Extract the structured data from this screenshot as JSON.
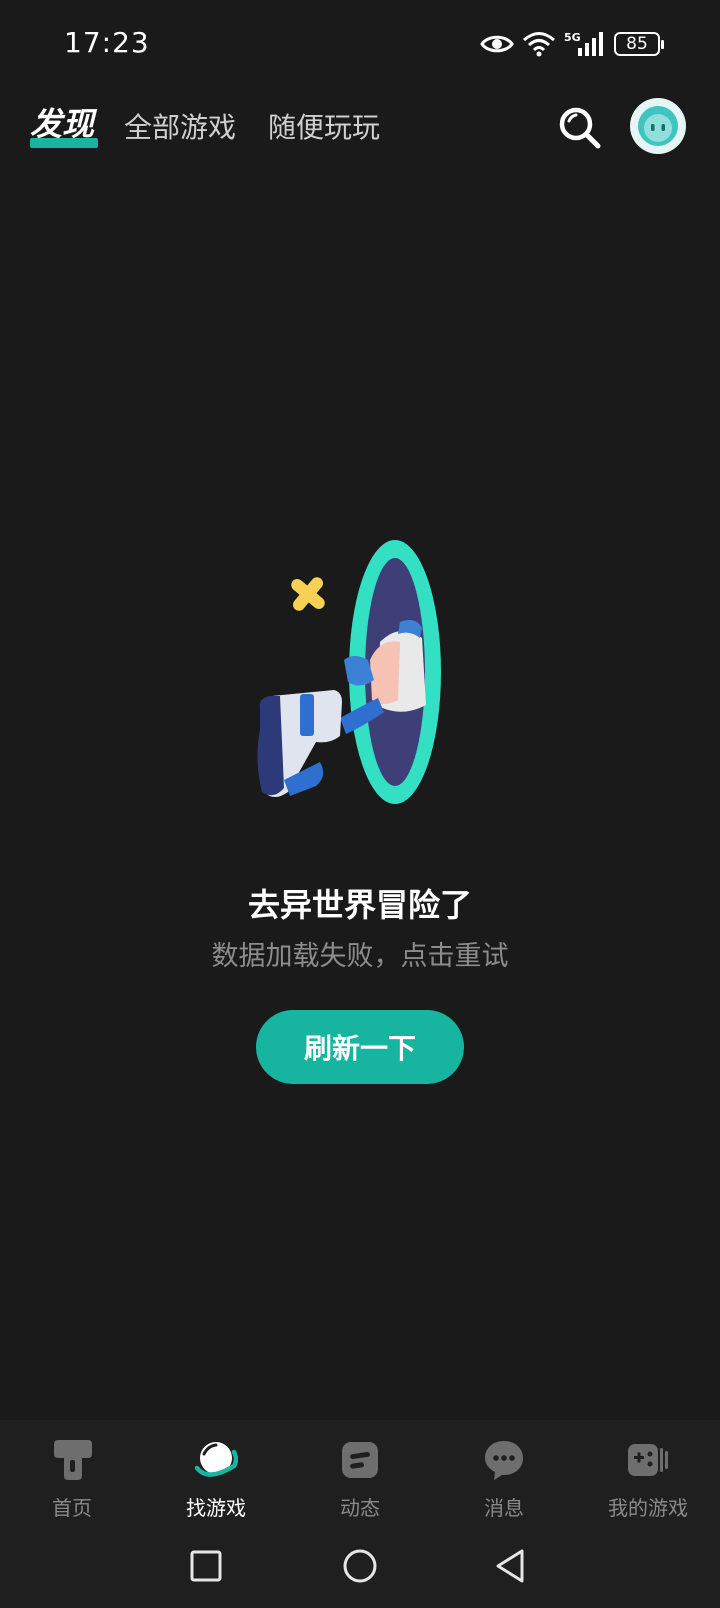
{
  "status_bar": {
    "time": "17:23",
    "network": "5G",
    "battery": "85"
  },
  "header": {
    "tabs": [
      {
        "label": "发现",
        "active": true
      },
      {
        "label": "全部游戏",
        "active": false
      },
      {
        "label": "随便玩玩",
        "active": false
      }
    ],
    "search_icon": "search-icon",
    "avatar_icon": "robot-avatar"
  },
  "empty_state": {
    "title": "去异世界冒险了",
    "subtitle": "数据加载失败，点击重试",
    "button_label": "刷新一下"
  },
  "bottom_nav": {
    "items": [
      {
        "label": "首页",
        "icon": "home-icon",
        "active": false
      },
      {
        "label": "找游戏",
        "icon": "planet-icon",
        "active": true
      },
      {
        "label": "动态",
        "icon": "feed-icon",
        "active": false
      },
      {
        "label": "消息",
        "icon": "message-icon",
        "active": false
      },
      {
        "label": "我的游戏",
        "icon": "gamepad-icon",
        "active": false
      }
    ]
  },
  "colors": {
    "background": "#1a1a1a",
    "accent": "#17b5a0",
    "inactive": "#8a8a8a"
  }
}
